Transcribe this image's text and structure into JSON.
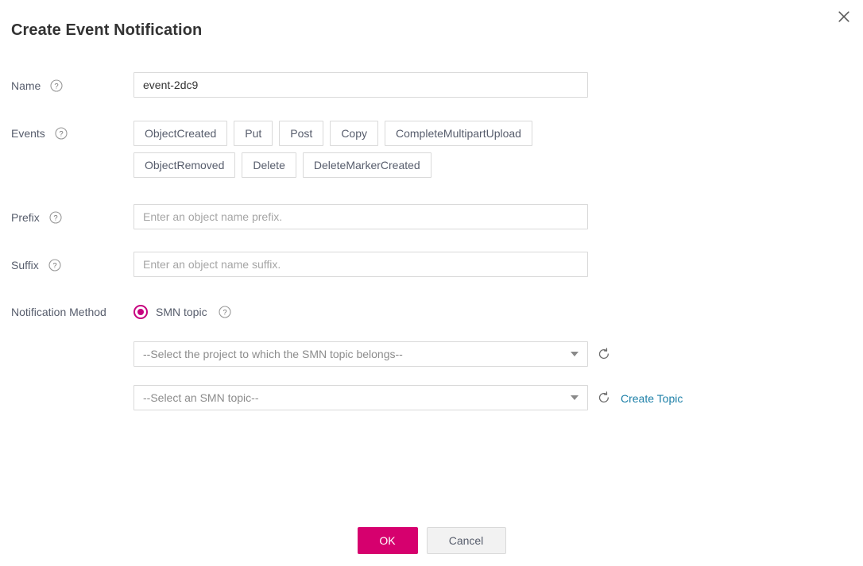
{
  "dialog": {
    "title": "Create Event Notification",
    "close_icon": "close-icon"
  },
  "fields": {
    "name": {
      "label": "Name",
      "help_icon": "help-icon",
      "value": "event-2dc9"
    },
    "events": {
      "label": "Events",
      "help_icon": "help-icon",
      "rows": [
        [
          "ObjectCreated",
          "Put",
          "Post",
          "Copy",
          "CompleteMultipartUpload"
        ],
        [
          "ObjectRemoved",
          "Delete",
          "DeleteMarkerCreated"
        ]
      ]
    },
    "prefix": {
      "label": "Prefix",
      "help_icon": "help-icon",
      "value": "",
      "placeholder": "Enter an object name prefix."
    },
    "suffix": {
      "label": "Suffix",
      "help_icon": "help-icon",
      "value": "",
      "placeholder": "Enter an object name suffix."
    },
    "notification_method": {
      "label": "Notification Method",
      "radio_label": "SMN topic",
      "radio_selected": true,
      "help_icon": "help-icon",
      "project_select": {
        "value": "--Select the project to which the SMN topic belongs--",
        "refresh_icon": "refresh-icon"
      },
      "topic_select": {
        "value": "--Select an SMN topic--",
        "refresh_icon": "refresh-icon",
        "create_link": "Create Topic"
      }
    }
  },
  "footer": {
    "ok_label": "OK",
    "cancel_label": "Cancel"
  },
  "colors": {
    "accent": "#d6006e",
    "radio": "#c7017f",
    "link": "#1e80a8",
    "border": "#d9d9d9",
    "label_text": "#575d6c"
  }
}
